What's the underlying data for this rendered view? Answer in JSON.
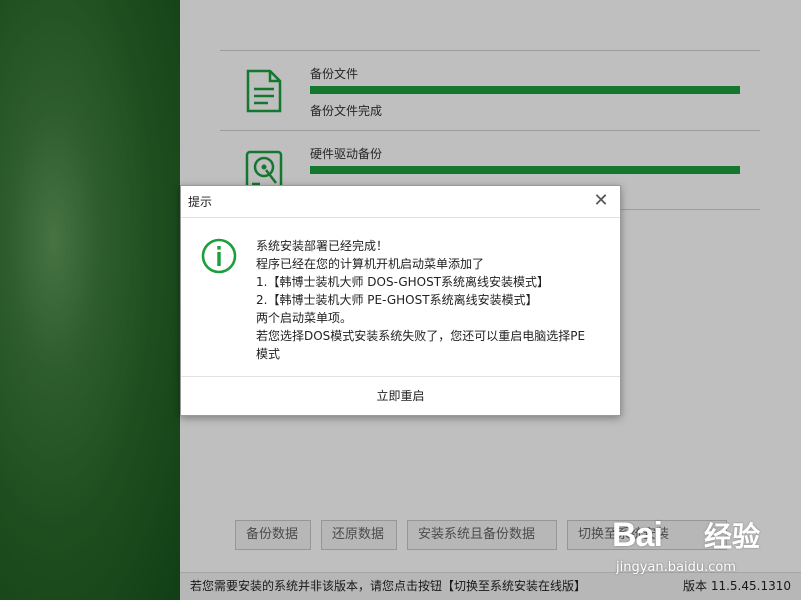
{
  "window": {
    "minimize_glyph": "—",
    "close_glyph": "✕"
  },
  "tasks": [
    {
      "title": "备份文件",
      "status": "备份文件完成",
      "progress": 1.0,
      "icon": "document-icon"
    },
    {
      "title": "硬件驱动备份",
      "status": "",
      "progress": 1.0,
      "icon": "hard-drive-icon"
    }
  ],
  "buttons": {
    "backup": "备份数据",
    "restore": "还原数据",
    "install_backup": "安装系统且备份数据",
    "switch_online": "切换至系统安装"
  },
  "statusbar": {
    "message": "若您需要安装的系统并非该版本，请您点击按钮【切换至系统安装在线版】",
    "version": "版本 11.5.45.1310"
  },
  "dialog": {
    "title": "提示",
    "lines": [
      "系统安装部署已经完成！",
      "程序已经在您的计算机开机启动菜单添加了",
      "1.【韩博士装机大师 DOS-GHOST系统离线安装模式】",
      "2.【韩博士装机大师 PE-GHOST系统离线安装模式】",
      "两个启动菜单项。",
      "若您选择DOS模式安装系统失败了，您还可以重启电脑选择PE",
      "模式"
    ],
    "action": "立即重启"
  },
  "colors": {
    "progress": "#1aa03c",
    "icon": "#1a9f3c",
    "left_panel": "#2a6a2b"
  },
  "watermark": {
    "brand": "Bai",
    "brand_cn": "经验",
    "url": "jingyan.baidu.com"
  }
}
